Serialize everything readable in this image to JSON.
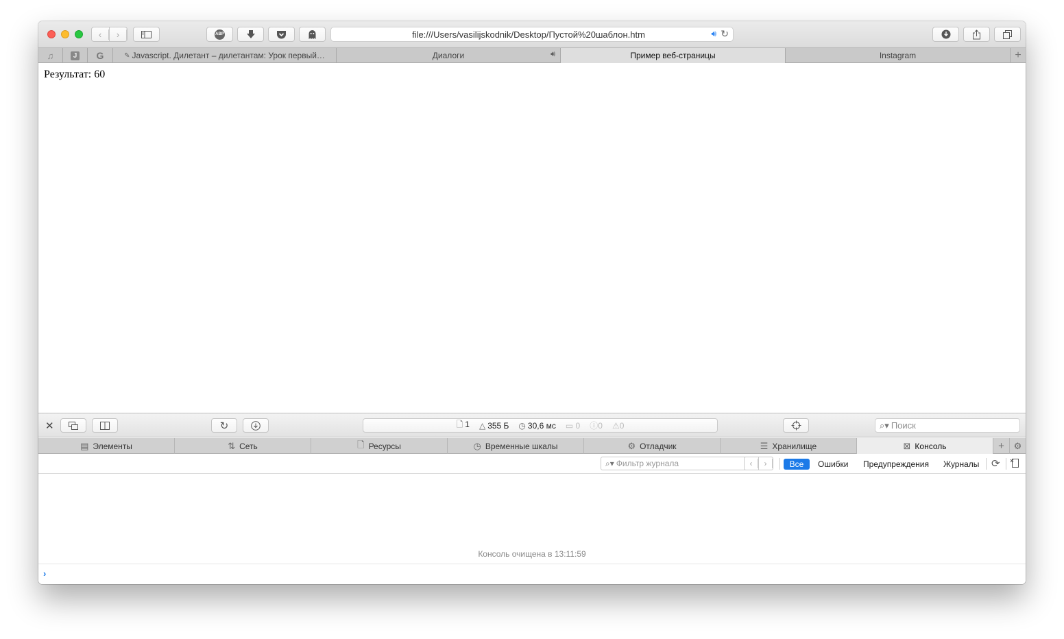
{
  "browser": {
    "url": "file:///Users/vasilijskodnik/Desktop/Пустой%20шаблон.htm",
    "extensions": {
      "adblock_label": "ABP"
    }
  },
  "tabs": {
    "pinned": [
      {
        "icon": "music-note-icon"
      },
      {
        "icon": "j-icon",
        "label": "J"
      },
      {
        "icon": "google-g-icon",
        "label": "G"
      }
    ],
    "items": [
      {
        "label": "Javascript. Дилетант – дилетантам: Урок первый…",
        "icon": "pencil-icon"
      },
      {
        "label": "Диалоги",
        "audio": true
      },
      {
        "label": "Пример веб-страницы",
        "active": true
      },
      {
        "label": "Instagram"
      }
    ]
  },
  "page": {
    "result_text": "Результат: 60"
  },
  "devtools": {
    "status": {
      "resources": "1",
      "size": "355 Б",
      "time": "30,6 мс",
      "logs": "0",
      "errors": "0",
      "warnings": "0"
    },
    "search_placeholder": "Поиск",
    "tabs": [
      {
        "label": "Элементы",
        "icon": "elements-icon"
      },
      {
        "label": "Сеть",
        "icon": "network-icon"
      },
      {
        "label": "Ресурсы",
        "icon": "resources-icon"
      },
      {
        "label": "Временные шкалы",
        "icon": "timeline-icon"
      },
      {
        "label": "Отладчик",
        "icon": "debugger-icon"
      },
      {
        "label": "Хранилище",
        "icon": "storage-icon"
      },
      {
        "label": "Консоль",
        "icon": "console-icon",
        "active": true
      }
    ],
    "console": {
      "filter_placeholder": "Фильтр журнала",
      "filters": {
        "all": "Все",
        "errors": "Ошибки",
        "warnings": "Предупреждения",
        "logs": "Журналы"
      },
      "cleared_message": "Консоль очищена в 13:11:59"
    }
  },
  "colors": {
    "accent": "#1b7ae8",
    "close": "#fc5f57",
    "minimize": "#fdbc2e",
    "zoom": "#28c841"
  }
}
